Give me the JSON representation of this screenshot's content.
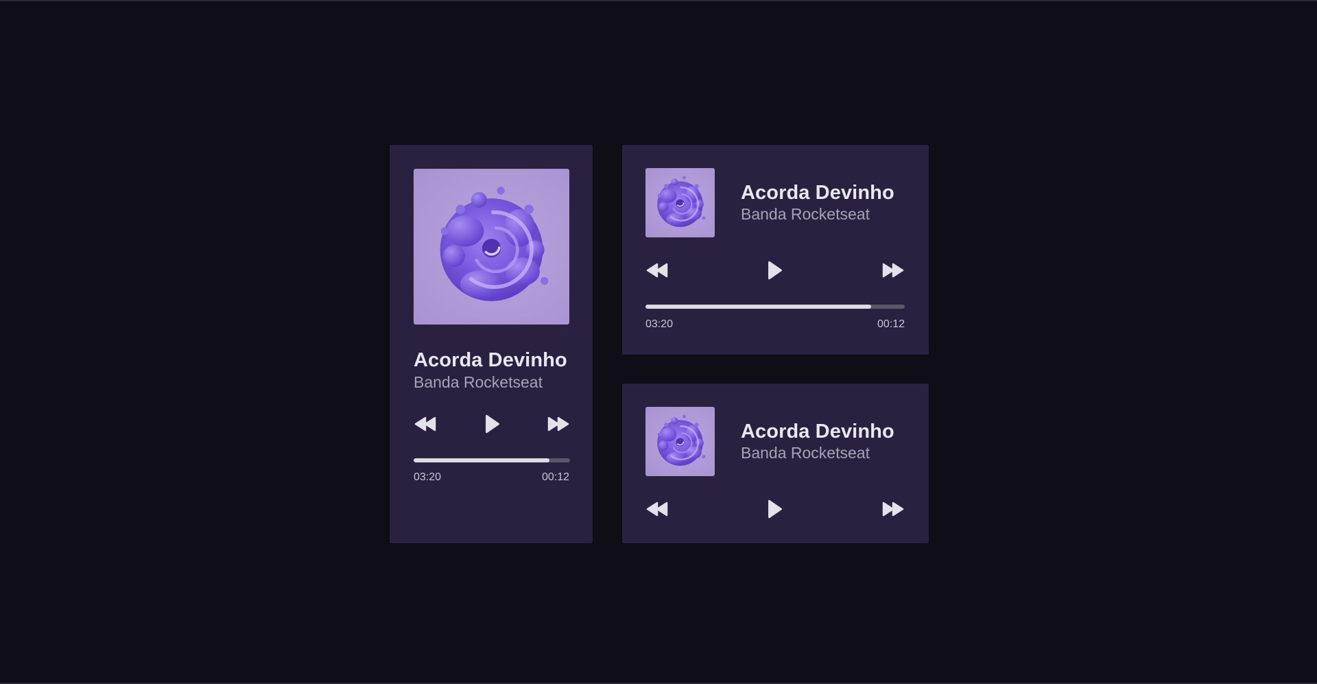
{
  "colors": {
    "background": "#0f0d15",
    "card": "#2a2141",
    "cover": "#b19cd8",
    "accent_purple": "#7a5ae0",
    "progress_fill": "#dedbe6",
    "progress_track": "#5c5669"
  },
  "players": [
    {
      "variant": "tall",
      "title": "Acorda Devinho",
      "artist": "Banda Rocketseat",
      "cover_icon": "album-cover-3d-blob",
      "controls": [
        "rewind-icon",
        "play-icon",
        "fast-forward-icon"
      ],
      "progress": 0.87,
      "elapsed": "03:20",
      "remaining": "00:12"
    },
    {
      "variant": "wide",
      "title": "Acorda Devinho",
      "artist": "Banda Rocketseat",
      "cover_icon": "album-cover-3d-blob",
      "controls": [
        "rewind-icon",
        "play-icon",
        "fast-forward-icon"
      ],
      "progress": 0.87,
      "elapsed": "03:20",
      "remaining": "00:12"
    },
    {
      "variant": "compact",
      "title": "Acorda Devinho",
      "artist": "Banda Rocketseat",
      "cover_icon": "album-cover-3d-blob",
      "controls": [
        "rewind-icon",
        "play-icon",
        "fast-forward-icon"
      ]
    }
  ]
}
